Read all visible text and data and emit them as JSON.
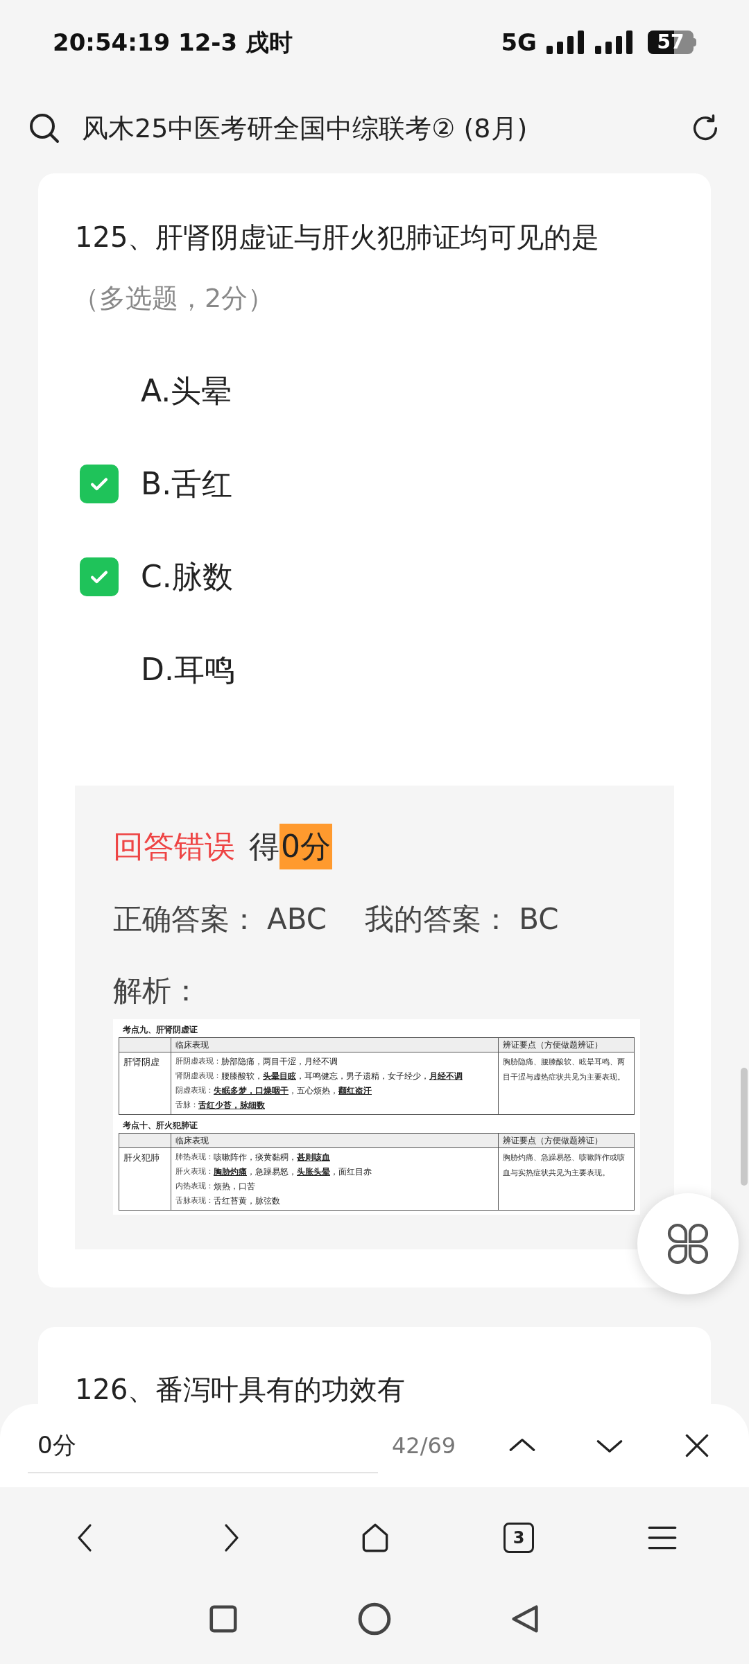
{
  "status_bar": {
    "time": "20:54:19 12-3 戌时",
    "network": "5G",
    "battery": "57"
  },
  "header": {
    "title": "风木25中医考研全国中综联考② (8月)"
  },
  "question": {
    "title": "125、肝肾阴虚证与肝火犯肺证均可见的是",
    "subtitle": "（多选题，2分）",
    "options": [
      {
        "label": "A.头晕",
        "checked": false
      },
      {
        "label": "B.舌红",
        "checked": true
      },
      {
        "label": "C.脉数",
        "checked": true
      },
      {
        "label": "D.耳鸣",
        "checked": false
      }
    ],
    "result": {
      "verdict": "回答错误",
      "score_prefix": "得",
      "score": "0分",
      "score_highlighted": true,
      "correct_label": "正确答案：",
      "correct": "ABC",
      "mine_label": "我的答案：",
      "mine": "BC",
      "analysis_label": "解析："
    },
    "analysis_table": [
      {
        "heading": "考点九、肝肾阴虚证",
        "columns": [
          "临床表现",
          "辨证要点（方便做题辨证）"
        ],
        "name": "肝肾阴虚",
        "lines": [
          {
            "label": "肝阴虚表现：",
            "text": "胁部隐痛，两目干涩，月经不调"
          },
          {
            "label": "肾阴虚表现：",
            "text": "腰膝酸软，**头晕目眩**，耳鸣健忘，男子遗精，女子经少，**月经不调**"
          },
          {
            "label": "阴虚表现：",
            "text": "**失眠多梦，口燥咽干**，五心烦热，**颧红盗汗**"
          },
          {
            "label": "舌脉：",
            "text": "**舌红少苔，脉细数**"
          }
        ],
        "points": "胸胁隐痛、腰膝酸软、眩晕耳鸣、两目干涩与虚热症状共见为主要表现。"
      },
      {
        "heading": "考点十、肝火犯肺证",
        "columns": [
          "临床表现",
          "辨证要点（方便做题辨证）"
        ],
        "name": "肝火犯肺",
        "lines": [
          {
            "label": "肺热表现：",
            "text": "咳嗽阵作，痰黄黏稠，**甚则咳血**"
          },
          {
            "label": "肝火表现：",
            "text": "**胸胁灼痛**，急躁易怒，**头胀头晕**，面红目赤"
          },
          {
            "label": "内热表现：",
            "text": "烦热，口苦"
          },
          {
            "label": "舌脉表现：",
            "text": "舌红苔黄，脉弦数"
          }
        ],
        "points": "胸胁灼痛、急躁易怒、咳嗽阵作或咳血与实热症状共见为主要表现。"
      }
    ]
  },
  "next_question": {
    "title": "126、番泻叶具有的功效有"
  },
  "find_bar": {
    "value": "0分",
    "count": "42/69"
  },
  "nav_bar": {
    "tabs_count": "3"
  }
}
